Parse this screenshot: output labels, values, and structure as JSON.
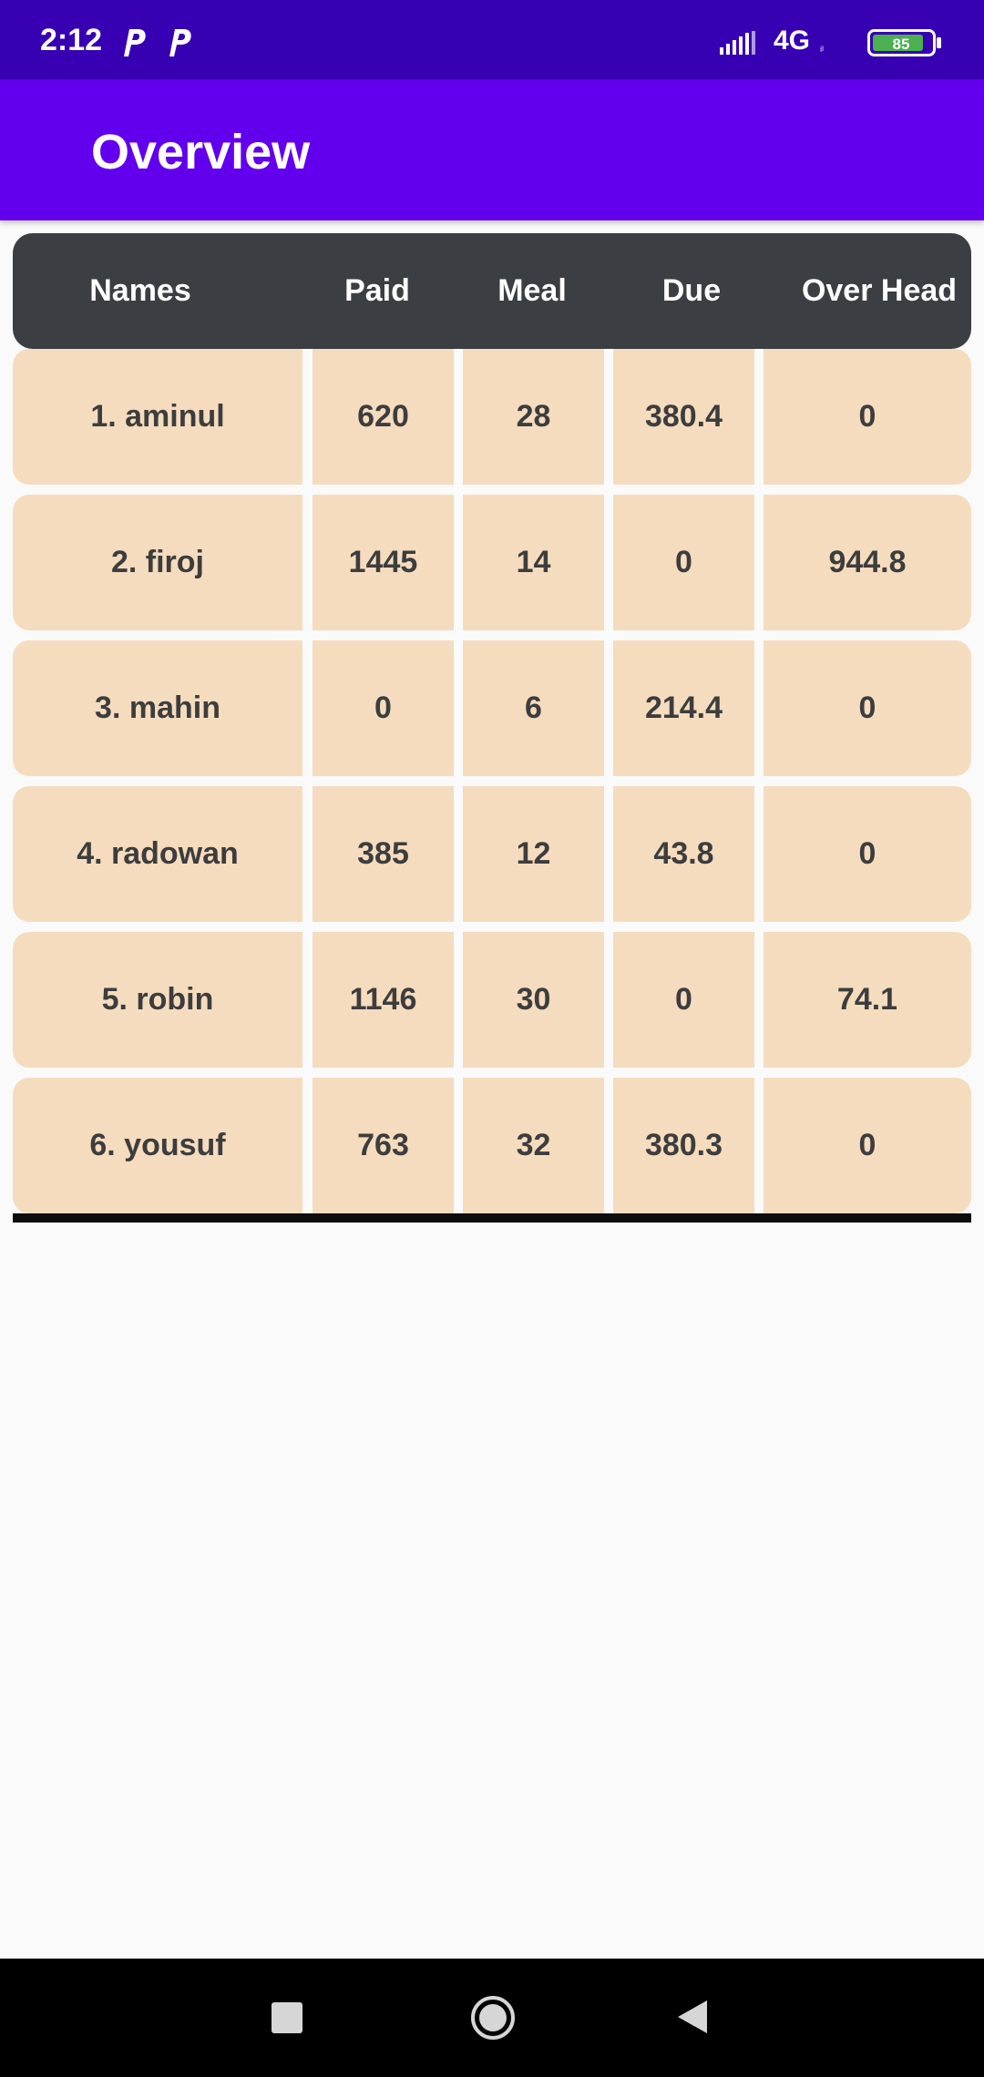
{
  "status_bar": {
    "time": "2:12",
    "app_icons": [
      "p-notification-icon",
      "p-notification-icon"
    ],
    "network": "4G",
    "network_sub": "ᵢₗ",
    "battery_level": "85",
    "icons": {
      "signal": "signal-icon",
      "battery": "battery-icon"
    }
  },
  "app_bar": {
    "title": "Overview"
  },
  "table": {
    "headers": [
      "Names",
      "Paid",
      "Meal",
      "Due",
      "Over Head"
    ],
    "rows": [
      {
        "name": "1. aminul",
        "paid": "620",
        "meal": "28",
        "due": "380.4",
        "over_head": "0"
      },
      {
        "name": "2. firoj",
        "paid": "1445",
        "meal": "14",
        "due": "0",
        "over_head": "944.8"
      },
      {
        "name": "3. mahin",
        "paid": "0",
        "meal": "6",
        "due": "214.4",
        "over_head": "0"
      },
      {
        "name": "4. radowan",
        "paid": "385",
        "meal": "12",
        "due": "43.8",
        "over_head": "0"
      },
      {
        "name": "5. robin",
        "paid": "1146",
        "meal": "30",
        "due": "0",
        "over_head": "74.1"
      },
      {
        "name": "6. yousuf",
        "paid": "763",
        "meal": "32",
        "due": "380.3",
        "over_head": "0"
      }
    ]
  },
  "nav_bar": {
    "icons": [
      "recents-icon",
      "home-icon",
      "back-icon"
    ]
  },
  "colors": {
    "status_bar": "#3700b3",
    "app_bar": "#6200ee",
    "header_bg": "#3b3e42",
    "cell_bg": "#f5dcbf",
    "cell_text": "#3d3d3d",
    "battery_fill": "#4caf50"
  }
}
